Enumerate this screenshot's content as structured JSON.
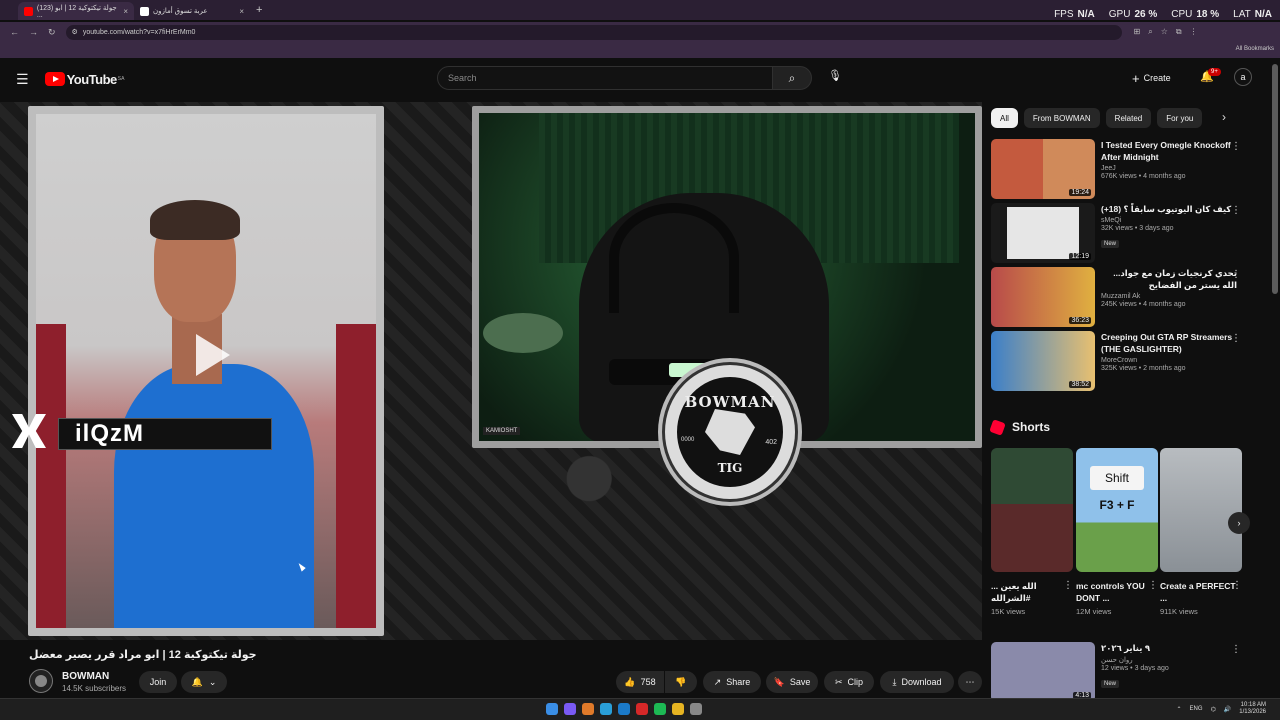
{
  "browser": {
    "tabs": [
      {
        "label": "(123) جولة تيكتوكية 12 | ابو ...",
        "active": true
      },
      {
        "label": "عربة تسوق أمازون",
        "active": false
      }
    ],
    "url": "youtube.com/watch?v=x7fiHrErMm0",
    "bookmarks_label": "All Bookmarks"
  },
  "hud": {
    "fps_label": "FPS",
    "fps_value": "N/A",
    "gpu_label": "GPU",
    "gpu_value": "26 %",
    "cpu_label": "CPU",
    "cpu_value": "18 %",
    "lat_label": "LAT",
    "lat_value": "N/A"
  },
  "youtube": {
    "logo_text": "YouTube",
    "region": "SA",
    "search_placeholder": "Search",
    "create_label": "Create",
    "notif_badge": "9+"
  },
  "player": {
    "watermark_text": "ilQzM",
    "cam_label": "KAMIOSHT",
    "emblem_top": "BOWMAN",
    "emblem_bottom": "TIG",
    "emblem_left": "0000",
    "emblem_right": "402"
  },
  "video": {
    "title": "جولة تيكتوكية 12 | ابو مراد قرر يصير معضل",
    "channel": "BOWMAN",
    "subscribers": "14.5K subscribers",
    "join_label": "Join",
    "likes": "758",
    "share_label": "Share",
    "save_label": "Save",
    "clip_label": "Clip",
    "download_label": "Download"
  },
  "chips": [
    "All",
    "From BOWMAN",
    "Related",
    "For you"
  ],
  "recommendations": [
    {
      "title": "I Tested Every Omegle Knockoff After Midnight",
      "channel": "JeeJ",
      "meta": "676K views • 4 months ago",
      "duration": "19:24",
      "new": "",
      "thumb": "#b54b4b"
    },
    {
      "title": "كيف كان اليوتيوب سابقاً ؟ (18+)",
      "channel": "sMeQi",
      "meta": "32K views • 3 days ago",
      "duration": "12:19",
      "new": "New",
      "thumb": "#d8d8d8"
    },
    {
      "title": "تحدي كرنجيات زمان مع جواد... الله يستر من الفضايح",
      "channel": "Muzzamil Ak",
      "meta": "245K views • 4 months ago",
      "duration": "36:23",
      "new": "",
      "thumb": "#c05050"
    },
    {
      "title": "Creeping Out GTA RP Streamers (THE GASLIGHTER)",
      "channel": "MoreCrown",
      "meta": "325K views • 2 months ago",
      "duration": "38:52",
      "new": "",
      "thumb": "#3b7fc9"
    },
    {
      "title": "٩ يناير ٢٠٢٦",
      "channel": "روان حسن",
      "meta": "12 views • 3 days ago",
      "duration": "4:13",
      "new": "New",
      "thumb": "#6c6c9a"
    }
  ],
  "shorts": {
    "header": "Shorts",
    "items": [
      {
        "title": "الله يعين ... #الشرالله",
        "views": "15K views",
        "thumb": "#2f4a34"
      },
      {
        "title": "mc controls YOU DONT ...",
        "views": "12M views",
        "thumb": "#79b3e0",
        "overlay": "Shift",
        "keys": "F3 + F"
      },
      {
        "title": "Create a PERFECT ...",
        "views": "911K views",
        "thumb": "#9aa3aa"
      }
    ]
  },
  "taskbar": {
    "lang": "ENG",
    "time": "10:18 AM",
    "date": "1/13/2026"
  }
}
